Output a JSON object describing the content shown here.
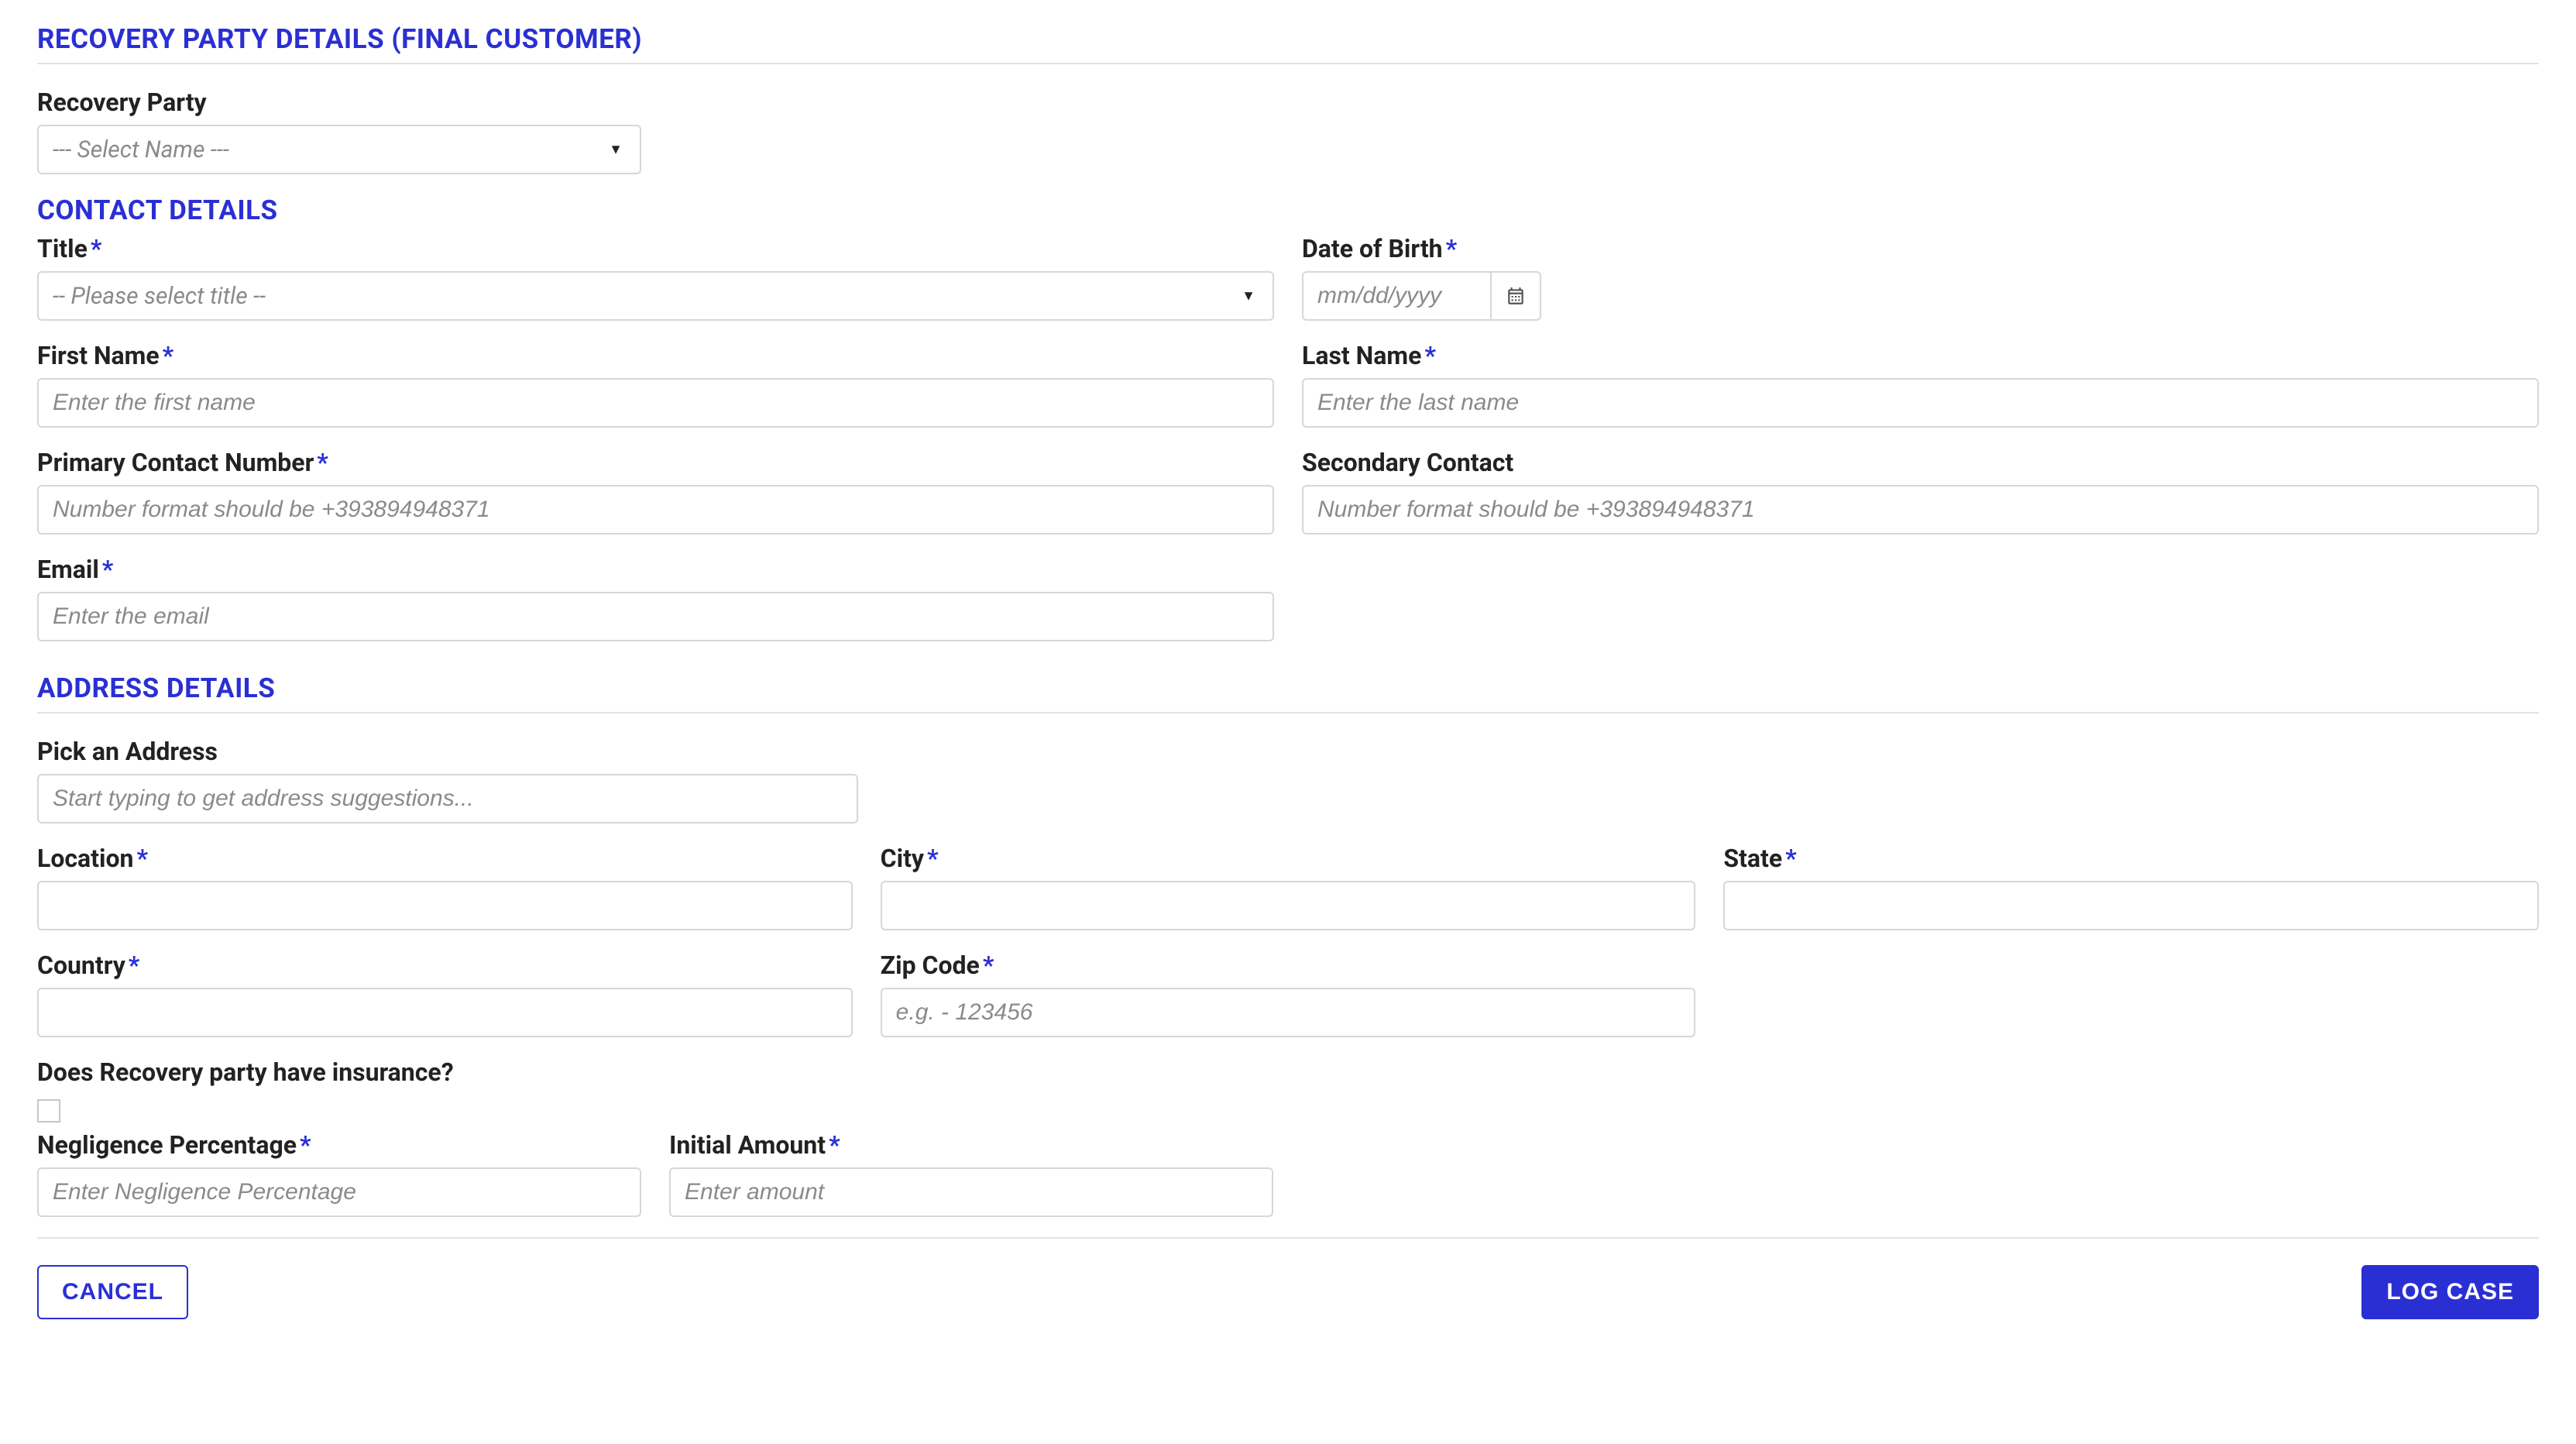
{
  "sections": {
    "recovery_party": "RECOVERY PARTY DETAILS (FINAL CUSTOMER)",
    "contact": "CONTACT DETAILS",
    "address": "ADDRESS DETAILS"
  },
  "labels": {
    "recovery_party": "Recovery Party",
    "title": "Title",
    "dob": "Date of Birth",
    "first_name": "First Name",
    "last_name": "Last Name",
    "primary_contact": "Primary Contact Number",
    "secondary_contact": "Secondary Contact",
    "email": "Email",
    "pick_address": "Pick an Address",
    "location": "Location",
    "city": "City",
    "state": "State",
    "country": "Country",
    "zip": "Zip Code",
    "insurance_q": "Does Recovery party have insurance?",
    "negligence": "Negligence Percentage",
    "initial_amount": "Initial Amount"
  },
  "placeholders": {
    "recovery_party_select": "--- Select Name ---",
    "title_select": "-- Please select title --",
    "dob": "mm/dd/yyyy",
    "first_name": "Enter the first name",
    "last_name": "Enter the last name",
    "phone": "Number format should be +393894948371",
    "email": "Enter the email",
    "pick_address": "Start typing to get address suggestions...",
    "zip": "e.g. - 123456",
    "negligence": "Enter Negligence Percentage",
    "initial_amount": "Enter amount"
  },
  "buttons": {
    "cancel": "CANCEL",
    "log_case": "LOG CASE"
  },
  "required_mark": "*"
}
